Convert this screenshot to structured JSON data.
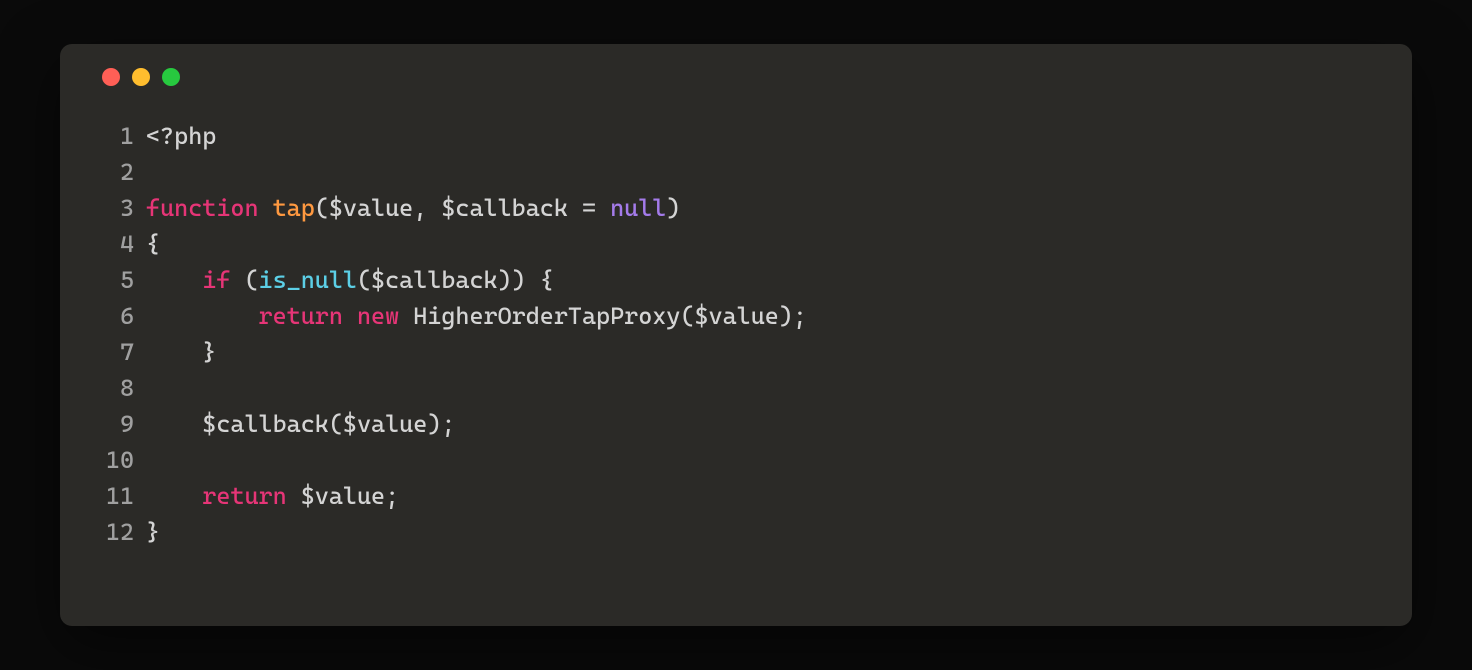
{
  "window": {
    "traffic_lights": [
      "red",
      "yellow",
      "green"
    ]
  },
  "code": {
    "lines": [
      {
        "n": "1",
        "tokens": [
          {
            "cls": "tok-phptag",
            "text": "<?php"
          }
        ]
      },
      {
        "n": "2",
        "tokens": []
      },
      {
        "n": "3",
        "tokens": [
          {
            "cls": "tok-keyword",
            "text": "function"
          },
          {
            "cls": "tok-plain",
            "text": " "
          },
          {
            "cls": "tok-funcname",
            "text": "tap"
          },
          {
            "cls": "tok-punct",
            "text": "("
          },
          {
            "cls": "tok-var",
            "text": "$value"
          },
          {
            "cls": "tok-punct",
            "text": ", "
          },
          {
            "cls": "tok-var",
            "text": "$callback"
          },
          {
            "cls": "tok-punct",
            "text": " = "
          },
          {
            "cls": "tok-null",
            "text": "null"
          },
          {
            "cls": "tok-punct",
            "text": ")"
          }
        ]
      },
      {
        "n": "4",
        "tokens": [
          {
            "cls": "tok-punct",
            "text": "{"
          }
        ]
      },
      {
        "n": "5",
        "tokens": [
          {
            "cls": "tok-plain",
            "text": "    "
          },
          {
            "cls": "tok-keyword",
            "text": "if"
          },
          {
            "cls": "tok-punct",
            "text": " ("
          },
          {
            "cls": "tok-funccall",
            "text": "is_null"
          },
          {
            "cls": "tok-punct",
            "text": "("
          },
          {
            "cls": "tok-var",
            "text": "$callback"
          },
          {
            "cls": "tok-punct",
            "text": ")) {"
          }
        ]
      },
      {
        "n": "6",
        "tokens": [
          {
            "cls": "tok-plain",
            "text": "        "
          },
          {
            "cls": "tok-keyword",
            "text": "return"
          },
          {
            "cls": "tok-plain",
            "text": " "
          },
          {
            "cls": "tok-keyword",
            "text": "new"
          },
          {
            "cls": "tok-plain",
            "text": " "
          },
          {
            "cls": "tok-class",
            "text": "HigherOrderTapProxy"
          },
          {
            "cls": "tok-punct",
            "text": "("
          },
          {
            "cls": "tok-var",
            "text": "$value"
          },
          {
            "cls": "tok-punct",
            "text": ");"
          }
        ]
      },
      {
        "n": "7",
        "tokens": [
          {
            "cls": "tok-plain",
            "text": "    "
          },
          {
            "cls": "tok-punct",
            "text": "}"
          }
        ]
      },
      {
        "n": "8",
        "tokens": []
      },
      {
        "n": "9",
        "tokens": [
          {
            "cls": "tok-plain",
            "text": "    "
          },
          {
            "cls": "tok-var",
            "text": "$callback"
          },
          {
            "cls": "tok-punct",
            "text": "("
          },
          {
            "cls": "tok-var",
            "text": "$value"
          },
          {
            "cls": "tok-punct",
            "text": ");"
          }
        ]
      },
      {
        "n": "10",
        "tokens": []
      },
      {
        "n": "11",
        "tokens": [
          {
            "cls": "tok-plain",
            "text": "    "
          },
          {
            "cls": "tok-keyword",
            "text": "return"
          },
          {
            "cls": "tok-plain",
            "text": " "
          },
          {
            "cls": "tok-var",
            "text": "$value"
          },
          {
            "cls": "tok-punct",
            "text": ";"
          }
        ]
      },
      {
        "n": "12",
        "tokens": [
          {
            "cls": "tok-punct",
            "text": "}"
          }
        ]
      }
    ]
  }
}
